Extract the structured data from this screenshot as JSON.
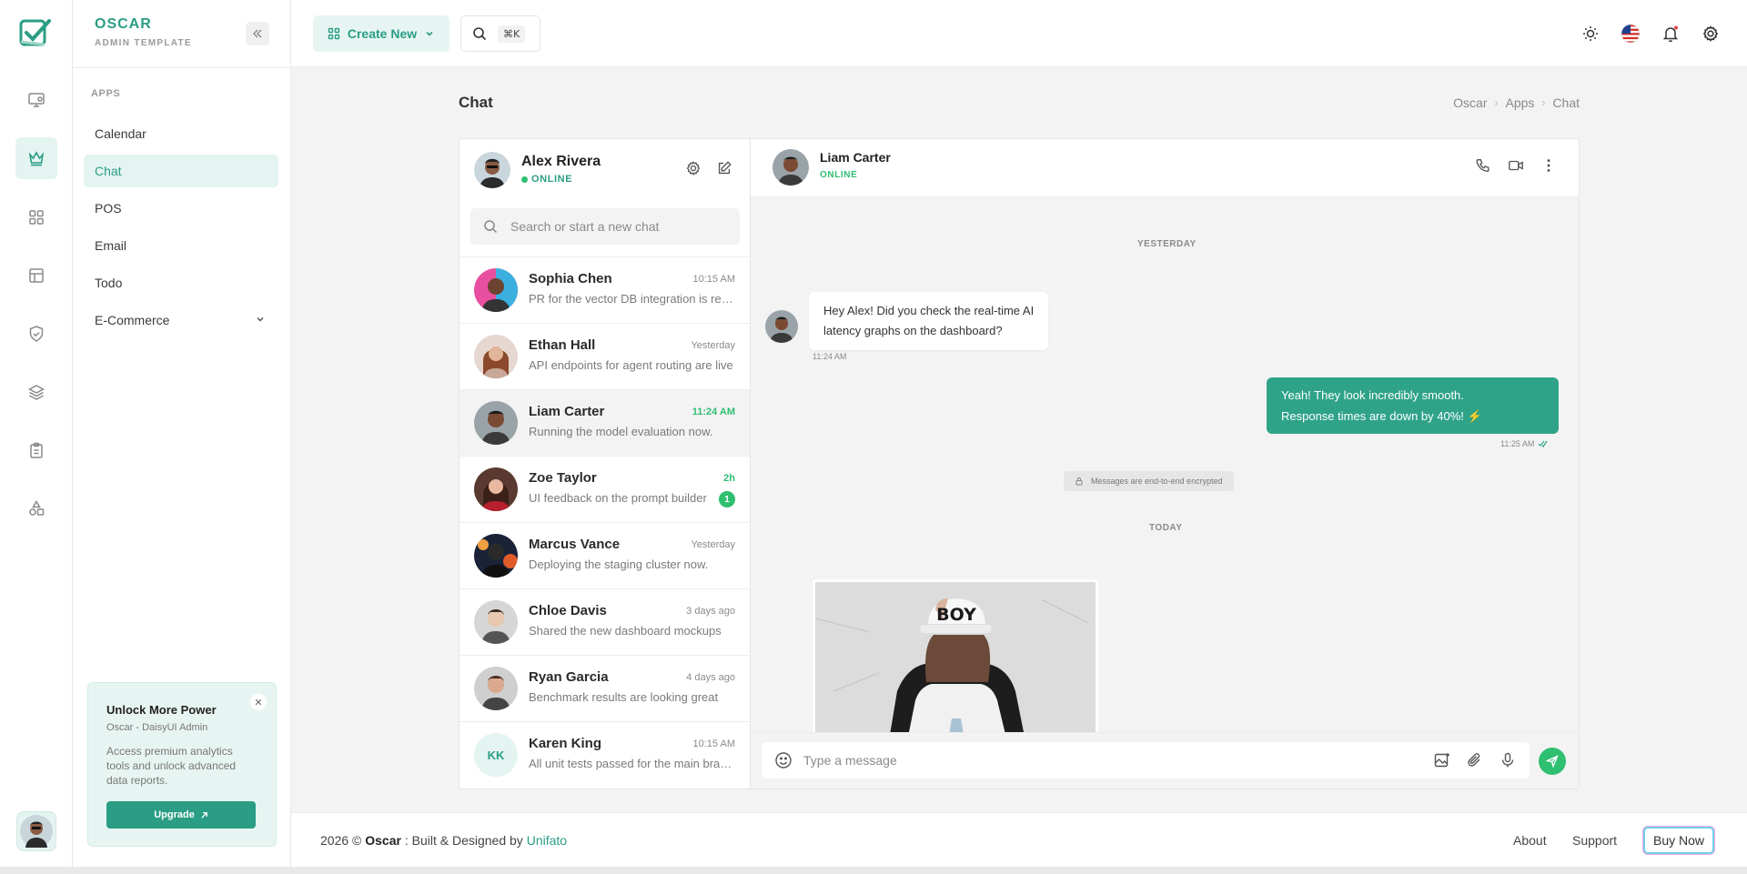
{
  "brand": {
    "name": "OSCAR",
    "subtitle": "ADMIN TEMPLATE"
  },
  "rail": {
    "icons": [
      "logo-icon",
      "monitor-icon",
      "crown-icon",
      "apps-grid-icon",
      "layout-icon",
      "shield-check-icon",
      "layers-icon",
      "clipboard-icon",
      "shapes-icon"
    ],
    "active": "crown-icon"
  },
  "sidebar": {
    "section": "APPS",
    "items": [
      {
        "label": "Calendar"
      },
      {
        "label": "Chat",
        "active": true
      },
      {
        "label": "POS"
      },
      {
        "label": "Email"
      },
      {
        "label": "Todo"
      },
      {
        "label": "E-Commerce",
        "has_children": true
      }
    ],
    "promo": {
      "title": "Unlock More Power",
      "subtitle": "Oscar - DaisyUI Admin",
      "description": "Access premium analytics tools and unlock advanced data reports.",
      "button": "Upgrade"
    }
  },
  "topbar": {
    "create_label": "Create New",
    "search_shortcut": "⌘K",
    "icons": [
      "sun-icon",
      "us-flag-icon",
      "bell-icon",
      "gear-icon"
    ]
  },
  "page": {
    "title": "Chat",
    "breadcrumb": [
      "Oscar",
      "Apps",
      "Chat"
    ]
  },
  "me": {
    "name": "Alex Rivera",
    "status": "ONLINE"
  },
  "contacts": {
    "search_placeholder": "Search or start a new chat",
    "items": [
      {
        "name": "Sophia Chen",
        "time": "10:15 AM",
        "preview": "PR for the vector DB integration is ready"
      },
      {
        "name": "Ethan Hall",
        "time": "Yesterday",
        "preview": "API endpoints for agent routing are live"
      },
      {
        "name": "Liam Carter",
        "time": "11:24 AM",
        "preview": "Running the model evaluation now.",
        "selected": true,
        "time_highlight": true
      },
      {
        "name": "Zoe Taylor",
        "time": "2h",
        "preview": "UI feedback on the prompt builder",
        "unread": "1",
        "time_highlight": true
      },
      {
        "name": "Marcus Vance",
        "time": "Yesterday",
        "preview": "Deploying the staging cluster now."
      },
      {
        "name": "Chloe Davis",
        "time": "3 days ago",
        "preview": "Shared the new dashboard mockups"
      },
      {
        "name": "Ryan Garcia",
        "time": "4 days ago",
        "preview": "Benchmark results are looking great"
      },
      {
        "name": "Karen King",
        "time": "10:15 AM",
        "preview": "All unit tests passed for the main branch",
        "initials": "KK"
      }
    ]
  },
  "conversation": {
    "name": "Liam Carter",
    "status": "ONLINE",
    "days": [
      "YESTERDAY",
      "TODAY"
    ],
    "messages": [
      {
        "direction": "in",
        "line1": "Hey Alex! Did you check the real-time AI",
        "line2": "latency graphs on the dashboard?",
        "time": "11:24 AM"
      },
      {
        "direction": "out",
        "line1": "Yeah! They look incredibly smooth.",
        "line2": "Response times are down by 40%! ⚡",
        "time": "11:25 AM"
      }
    ],
    "encryption_notice": "Messages are end-to-end encrypted",
    "image_caption": "BOY",
    "composer_placeholder": "Type a message"
  },
  "footer": {
    "prefix": "2026 © ",
    "brand": "Oscar",
    "middle": " : Built & Designed by ",
    "company": "Unifato",
    "links": [
      "About",
      "Support"
    ],
    "buy": "Buy Now"
  },
  "colors": {
    "accent": "#2a9d84",
    "online": "#2fbf71",
    "bubble_out": "#2fa388"
  }
}
